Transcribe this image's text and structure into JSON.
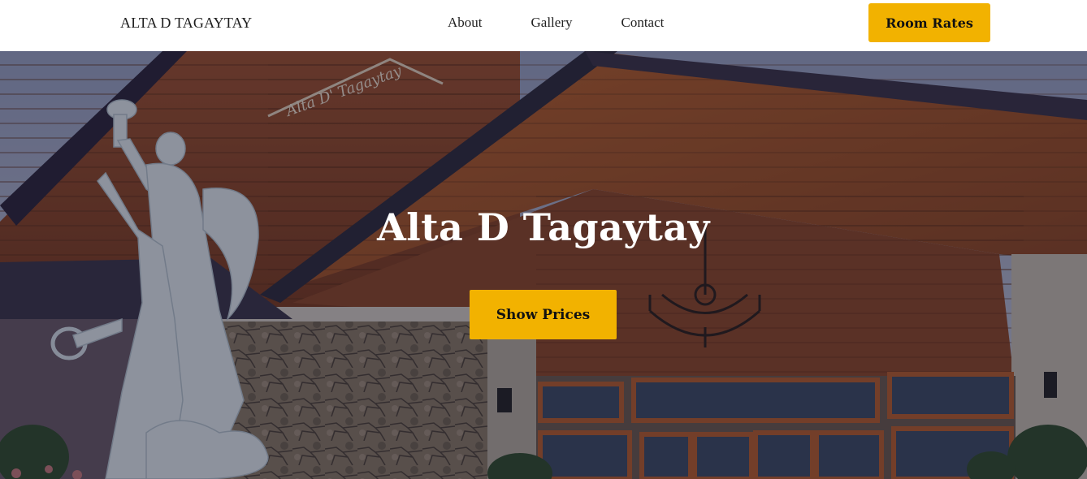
{
  "navbar": {
    "brand": "ALTA D TAGAYTAY",
    "links": [
      {
        "label": "About"
      },
      {
        "label": "Gallery"
      },
      {
        "label": "Contact"
      }
    ],
    "cta_label": "Room Rates",
    "cta_color": "#f2b200"
  },
  "hero": {
    "title": "Alta D Tagaytay",
    "button_label": "Show Prices",
    "sign_text": "Alta D' Tagaytay",
    "background_image": "hotel-facade-photo"
  }
}
